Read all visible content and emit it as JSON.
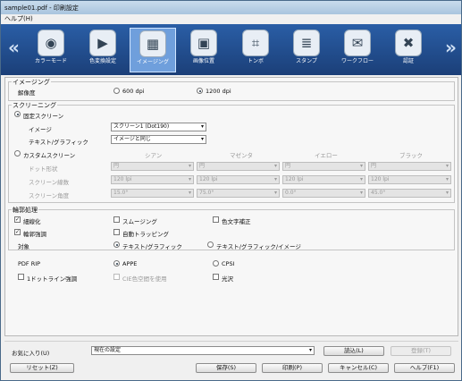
{
  "window": {
    "title": "sample01.pdf - 印刷設定",
    "menu_help": "ヘルプ(H)"
  },
  "toolbar": {
    "left_arrow": "«",
    "right_arrow": "»",
    "tabs": [
      {
        "label": "カラーモード",
        "icon": "color-mode-icon"
      },
      {
        "label": "色変換設定",
        "icon": "color-conversion-icon"
      },
      {
        "label": "イメージング",
        "icon": "imaging-icon"
      },
      {
        "label": "画像位置",
        "icon": "image-position-icon"
      },
      {
        "label": "トンボ",
        "icon": "crop-marks-icon"
      },
      {
        "label": "スタンプ",
        "icon": "stamp-icon"
      },
      {
        "label": "ワークフロー",
        "icon": "workflow-icon"
      },
      {
        "label": "認証",
        "icon": "authentication-icon"
      }
    ],
    "active_index": 2
  },
  "imaging": {
    "title": "イメージング",
    "resolution_label": "解像度",
    "res_600": "600 dpi",
    "res_1200": "1200 dpi"
  },
  "screening": {
    "title": "スクリーニング",
    "fixed_label": "固定スクリーン",
    "image_label": "イメージ",
    "image_value": "スクリーン1 (Dot190)",
    "text_label": "テキスト/グラフィック",
    "text_value": "イメージと同じ",
    "custom_label": "カスタムスクリーン",
    "columns": [
      "シアン",
      "マゼンタ",
      "イエロー",
      "ブラック"
    ],
    "rows": [
      {
        "label": "ドット形状",
        "values": [
          "円",
          "円",
          "円",
          "円"
        ]
      },
      {
        "label": "スクリーン線数",
        "values": [
          "120 lpi",
          "120 lpi",
          "120 lpi",
          "120 lpi"
        ]
      },
      {
        "label": "スクリーン角度",
        "values": [
          "15.0°",
          "75.0°",
          "0.0°",
          "45.0°"
        ]
      }
    ]
  },
  "edge": {
    "title": "輪郭処理",
    "thinning": "細線化",
    "smoothing": "スムージング",
    "color_char": "色文字補正",
    "edge_emphasis": "輪郭強調",
    "auto_trapping": "自動トラッピング",
    "target_label": "対象",
    "target_text": "テキスト/グラフィック",
    "target_all": "テキスト/グラフィック/イメージ"
  },
  "rip": {
    "label": "PDF RIP",
    "appe": "APPE",
    "cpsi": "CPSI",
    "dot_line": "1ドットライン強調",
    "cie": "CIE色空間を使用",
    "gloss": "光沢"
  },
  "footer": {
    "favorites_label": "お気に入り(U)",
    "favorites_value": "現在の設定",
    "load": "読込(L)",
    "register": "登録(T)",
    "reset": "リセット(Z)",
    "save": "保存(S)",
    "print": "印刷(P)",
    "cancel": "キャンセル(C)",
    "help": "ヘルプ(F1)"
  }
}
